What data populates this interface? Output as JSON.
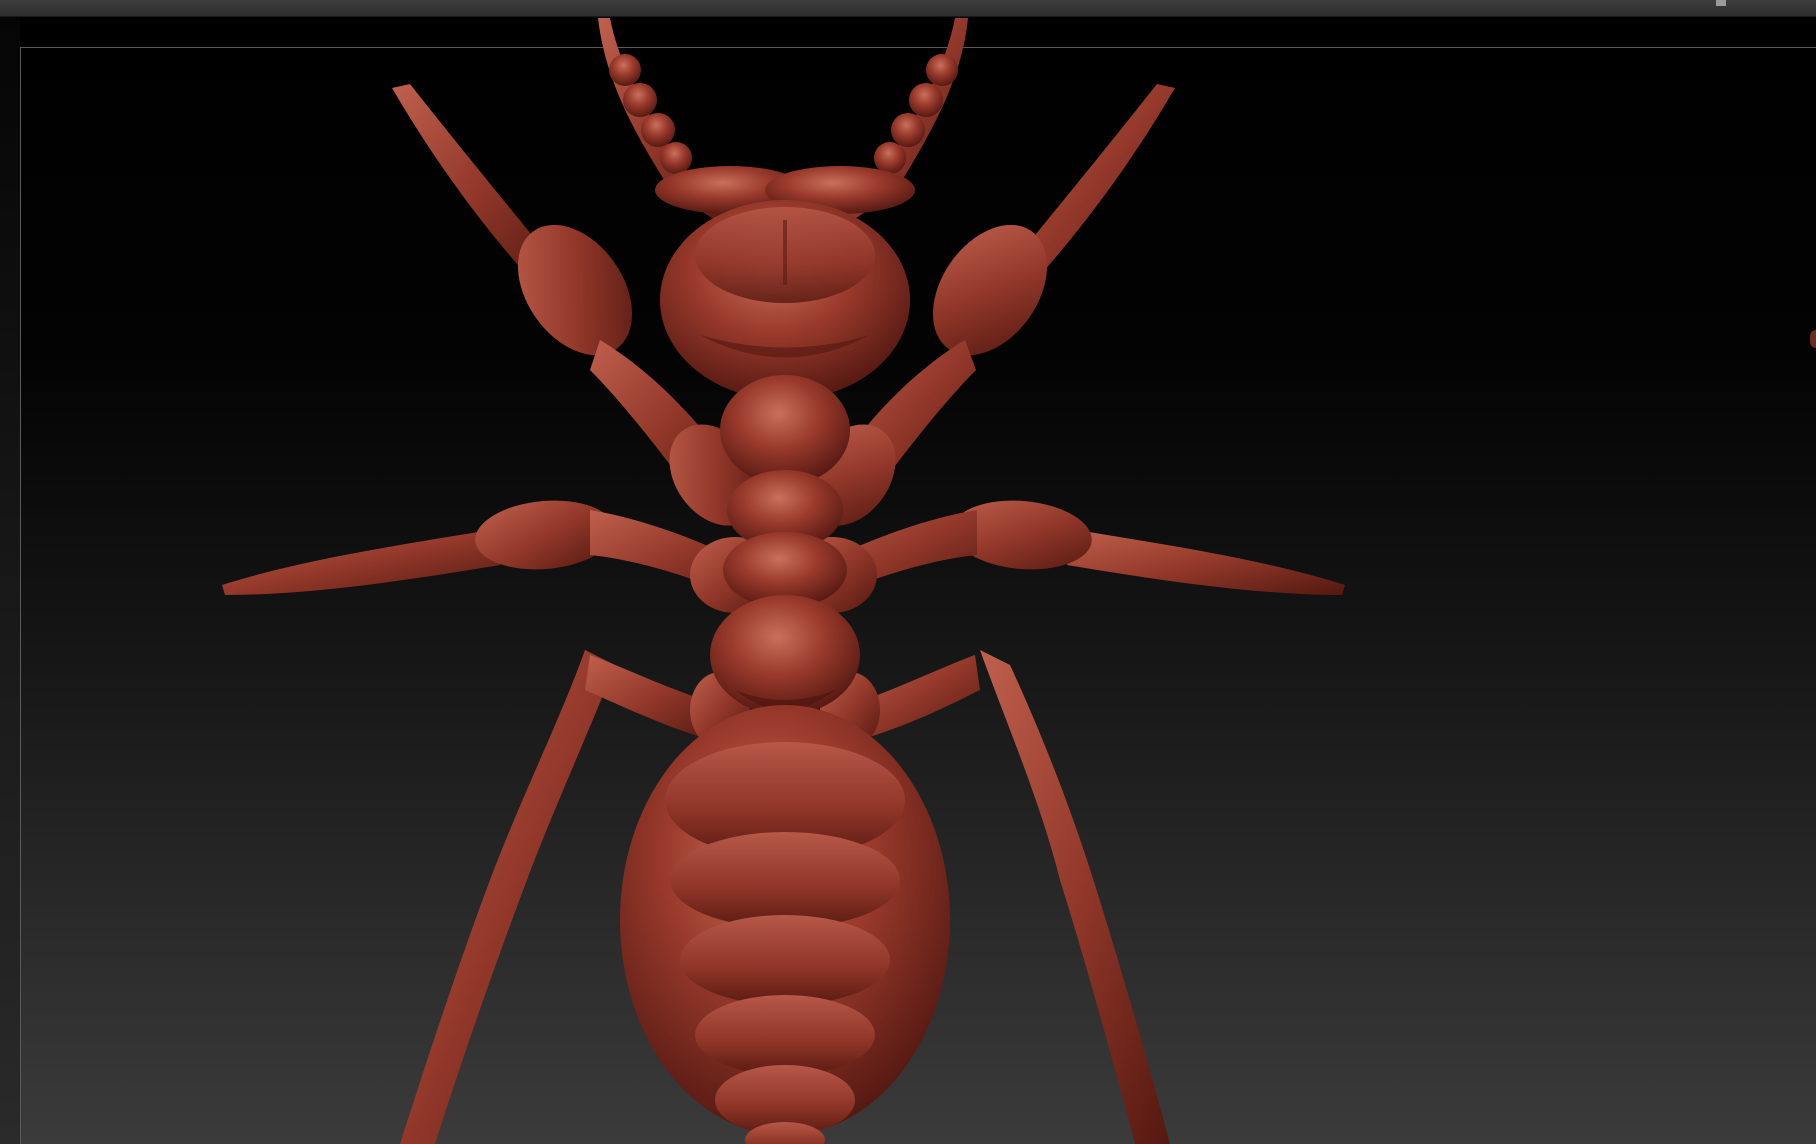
{
  "app": {
    "name": ""
  },
  "viewport": {
    "background_top": "#000000",
    "background_bottom": "#3b3b3b",
    "frame_color": "#5a5a5a"
  },
  "model": {
    "subject": "ant-sculpt",
    "base_color": "#9a3a2c",
    "highlight_color": "#c86a58",
    "shadow_color": "#4a140e"
  },
  "icons": {
    "top_marker": "scroll-marker-icon"
  }
}
